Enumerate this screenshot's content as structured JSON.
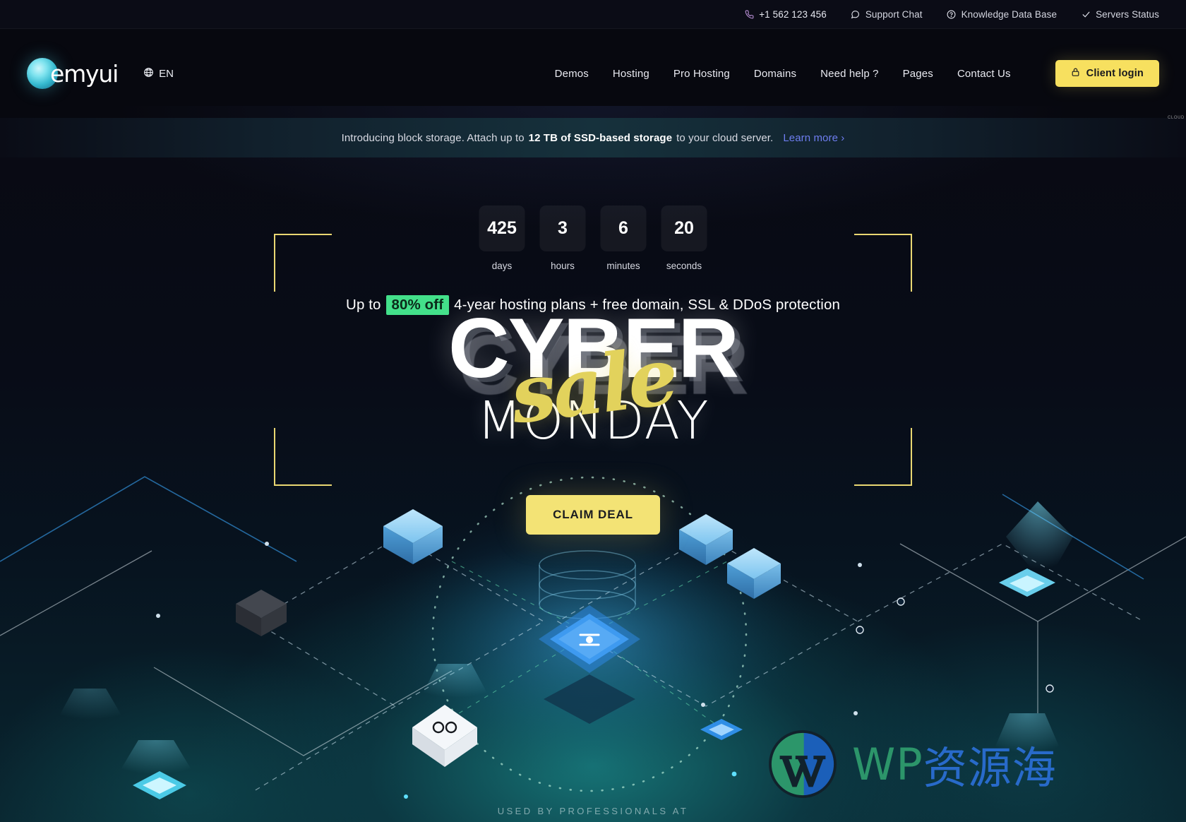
{
  "topbar": {
    "items": [
      {
        "icon": "phone-icon",
        "label": "+1 562 123 456"
      },
      {
        "icon": "chat-bubble-icon",
        "label": "Support Chat"
      },
      {
        "icon": "question-circle-icon",
        "label": "Knowledge Data Base"
      },
      {
        "icon": "check-icon",
        "label": "Servers Status"
      }
    ]
  },
  "nav": {
    "logo_text": "emyui",
    "logo_sub": "CLOUD",
    "lang": {
      "icon": "globe-icon",
      "label": "EN"
    },
    "links": [
      {
        "label": "Demos"
      },
      {
        "label": "Hosting"
      },
      {
        "label": "Pro Hosting"
      },
      {
        "label": "Domains"
      },
      {
        "label": "Need help ?"
      },
      {
        "label": "Pages"
      },
      {
        "label": "Contact Us"
      }
    ],
    "login": {
      "icon": "lock-icon",
      "label": "Client login"
    }
  },
  "announcement": {
    "before": "Introducing block storage. Attach up to",
    "bold": "12 TB of SSD-based storage",
    "after": "to your cloud server.",
    "link": "Learn more ›"
  },
  "hero": {
    "countdown": [
      {
        "value": "425",
        "label": "days"
      },
      {
        "value": "3",
        "label": "hours"
      },
      {
        "value": "6",
        "label": "minutes"
      },
      {
        "value": "20",
        "label": "seconds"
      }
    ],
    "promo_before": "Up to",
    "promo_highlight": "80% off",
    "promo_after": "4-year hosting plans + free domain, SSL & DDoS protection",
    "title_main": "CYBER",
    "title_script": "sale",
    "title_sub": "MONDAY",
    "cta": "CLAIM DEAL",
    "used_by": "USED BY PROFESSIONALS AT"
  },
  "watermark": {
    "logo": "wordpress-icon",
    "text_en": "WP",
    "text_cn": "资源海"
  },
  "colors": {
    "accent_yellow": "#f7e05f",
    "accent_green": "#43e08a",
    "link_blue": "#6e7df0",
    "bg_dark": "#07080f",
    "teal_glow": "#17787a"
  }
}
